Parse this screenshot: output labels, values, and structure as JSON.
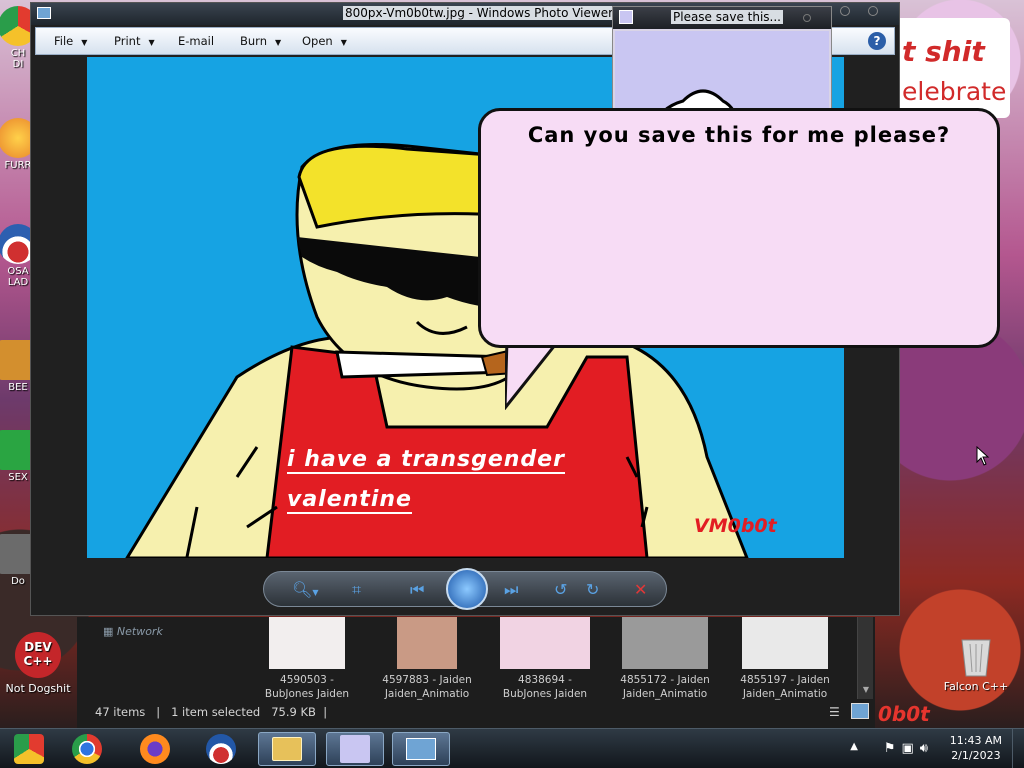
{
  "desktop": {
    "icons": [
      {
        "label": "CH\nDI",
        "color": "#1f9e3a"
      },
      {
        "label": "FURR",
        "color": "#e8832a"
      },
      {
        "label": "OSA\nLAD",
        "color": "#2c5fb0"
      },
      {
        "label": "BEE",
        "color": "#d38f2e"
      },
      {
        "label": "SEX",
        "color": "#2aa542"
      },
      {
        "label": "Do",
        "color": "#6b6b6b"
      }
    ],
    "dev_icon_label": "Not Dogshit",
    "dev_icon_text": "DEV\nC++",
    "recycle_label": "Falcon C++",
    "sign_line1": "t shit",
    "sign_line2": "elebrate",
    "wallpaper_text": "0b0t"
  },
  "viewer": {
    "title": "800px-Vm0b0tw.jpg - Windows Photo Viewer",
    "menu": [
      {
        "label": "File",
        "has_arrow": true
      },
      {
        "label": "Print",
        "has_arrow": true
      },
      {
        "label": "E-mail",
        "has_arrow": false
      },
      {
        "label": "Burn",
        "has_arrow": true
      },
      {
        "label": "Open",
        "has_arrow": true
      }
    ],
    "help_label": "?",
    "photo_text_line1": "i have a transgender",
    "photo_text_line2": "valentine",
    "photo_signature": "VM0b0t"
  },
  "bunny_window": {
    "title": "Please save this..."
  },
  "bubble": {
    "text": "Can you save this for me please?"
  },
  "explorer": {
    "network_label": "Network",
    "thumbnails": [
      {
        "line1": "4590503 -",
        "line2": "BubJones Jaiden"
      },
      {
        "line1": "4597883 - Jaiden",
        "line2": "Jaiden_Animatio"
      },
      {
        "line1": "4838694 -",
        "line2": "BubJones Jaiden"
      },
      {
        "line1": "4855172 - Jaiden",
        "line2": "Jaiden_Animatio"
      },
      {
        "line1": "4855197 - Jaiden",
        "line2": "Jaiden_Animatio"
      }
    ],
    "status": {
      "items": "47 items",
      "selected": "1 item selected",
      "size": "75.9 KB"
    }
  },
  "taskbar": {
    "time": "11:43 AM",
    "date": "2/1/2023",
    "apps": [
      {
        "name": "chrome-old",
        "color": "#e23b2f"
      },
      {
        "name": "chrome",
        "color": "#2a9d4a"
      },
      {
        "name": "firefox",
        "color": "#ff8a1e"
      },
      {
        "name": "obama",
        "color": "#2257a7"
      },
      {
        "name": "explorer",
        "color": "#e7c15a"
      },
      {
        "name": "bunny",
        "color": "#c9c6f2"
      },
      {
        "name": "photo-viewer",
        "color": "#6fa4d4"
      }
    ]
  }
}
